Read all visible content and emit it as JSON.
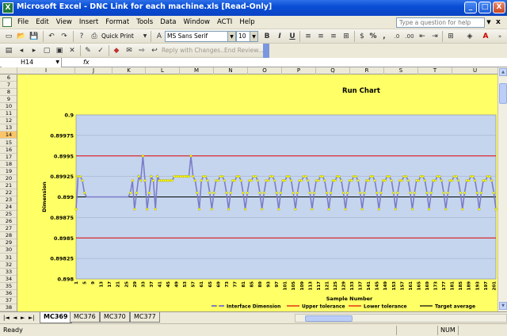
{
  "window": {
    "title": "Microsoft Excel - DNC Link for each machine.xls  [Read-Only]",
    "app_icon": "X",
    "controls": [
      "_",
      "□",
      "X"
    ]
  },
  "menu": {
    "items": [
      "File",
      "Edit",
      "View",
      "Insert",
      "Format",
      "Tools",
      "Data",
      "Window",
      "ACTI",
      "Help"
    ],
    "help_placeholder": "Type a question for help",
    "close_doc": "x"
  },
  "toolbar": {
    "quick_print": "Quick Print",
    "font_name": "MS Sans Serif",
    "font_size": "10",
    "bold": "B",
    "italic": "I",
    "underline": "U",
    "percent": "%",
    "comma": ",",
    "reply_with_changes": "Reply with Changes...",
    "end_review": "End Review..."
  },
  "formula_bar": {
    "name_box": "H14",
    "fx": "fx",
    "value": ""
  },
  "grid": {
    "columns": [
      "I",
      "J",
      "K",
      "L",
      "M",
      "N",
      "O",
      "P",
      "Q",
      "R",
      "S",
      "T",
      "U"
    ],
    "rows": [
      "6",
      "7",
      "8",
      "9",
      "10",
      "11",
      "12",
      "13",
      "14",
      "15",
      "16",
      "17",
      "18",
      "19",
      "20",
      "21",
      "22",
      "23",
      "24",
      "25",
      "26",
      "27",
      "28",
      "29",
      "30",
      "31",
      "32",
      "33",
      "34",
      "35",
      "36",
      "37",
      "38"
    ],
    "active_row": "14",
    "active_col": "H",
    "colors": {
      "cells": "#FFFF66",
      "header": "#ECE9D8",
      "active_header": "#F9C56A"
    }
  },
  "chart_data": {
    "type": "line",
    "title": "Run Chart",
    "xlabel": "Sample Number",
    "ylabel": "Dimension",
    "ylim": [
      0.898,
      0.9
    ],
    "y_ticks": [
      "0.9",
      "0.89975",
      "0.8995",
      "0.89925",
      "0.899",
      "0.89875",
      "0.8985",
      "0.89825",
      "0.898"
    ],
    "x_ticks": [
      "1",
      "5",
      "9",
      "13",
      "17",
      "21",
      "25",
      "29",
      "33",
      "37",
      "41",
      "45",
      "49",
      "53",
      "57",
      "61",
      "65",
      "69",
      "73",
      "77",
      "81",
      "85",
      "89",
      "93",
      "97",
      "101",
      "105",
      "109",
      "113",
      "117",
      "121",
      "125",
      "129",
      "133",
      "137",
      "141",
      "145",
      "149",
      "153",
      "157",
      "161",
      "165",
      "169",
      "173",
      "177",
      "181",
      "185",
      "189",
      "193",
      "197",
      "201"
    ],
    "x_range": [
      1,
      202
    ],
    "grid": "horizontal",
    "legend_position": "bottom",
    "colors": {
      "plot_area": "#C5D5EE",
      "series": "#7C7CC6",
      "marker": "#FFFF00",
      "upper": "#E00000",
      "lower": "#E00000",
      "target": "#000000"
    },
    "series": [
      {
        "name": "Interface Dimension",
        "pattern_note_free": true,
        "segments": [
          {
            "x": [
              1,
              2,
              3,
              4,
              5,
              6,
              7,
              8,
              9,
              10,
              11,
              12,
              13,
              14,
              15,
              16,
              17,
              18,
              19,
              20,
              21,
              22,
              23,
              24,
              25,
              26,
              27,
              28,
              29,
              30,
              31,
              32,
              33,
              34,
              35,
              36,
              37,
              38,
              39,
              40,
              41,
              42,
              43,
              44,
              45,
              46,
              47,
              48,
              49,
              50,
              51,
              52,
              53,
              54,
              55,
              56,
              57,
              58,
              59,
              60
            ],
            "y": [
              0.89885,
              0.89925,
              0.89925,
              0.8992,
              0.89905,
              0.899,
              0.899,
              0.899,
              0.899,
              0.899,
              0.899,
              0.899,
              0.899,
              0.899,
              0.899,
              0.899,
              0.899,
              0.899,
              0.899,
              0.899,
              0.899,
              0.899,
              0.899,
              0.899,
              0.899,
              0.899,
              0.89905,
              0.8992,
              0.89885,
              0.89905,
              0.89925,
              0.8992,
              0.8995,
              0.8992,
              0.89885,
              0.89905,
              0.89925,
              0.8992,
              0.89885,
              0.89925,
              0.8992,
              0.8992,
              0.8992,
              0.8992,
              0.8992,
              0.8992,
              0.8992,
              0.89925,
              0.89925,
              0.89925,
              0.89925,
              0.89925,
              0.89925,
              0.89925,
              0.89925,
              0.8995,
              0.89925,
              0.8992,
              0.89905,
              0.89885
            ]
          }
        ]
      }
    ],
    "limits": [
      {
        "name": "Upper tolerance",
        "value": 0.8995
      },
      {
        "name": "Lower tolerance",
        "value": 0.8985
      },
      {
        "name": "Target average",
        "value": 0.899
      }
    ],
    "legend": [
      "Interface Dimension",
      "Upper tolerance",
      "Lower tolerance",
      "Target average"
    ]
  },
  "sheets": {
    "tabs": [
      "MC369",
      "MC376",
      "MC370",
      "MC377"
    ],
    "active": "MC369",
    "nav": [
      "|◄",
      "◄",
      "►",
      "►|"
    ]
  },
  "status": {
    "ready": "Ready",
    "num": "NUM"
  }
}
